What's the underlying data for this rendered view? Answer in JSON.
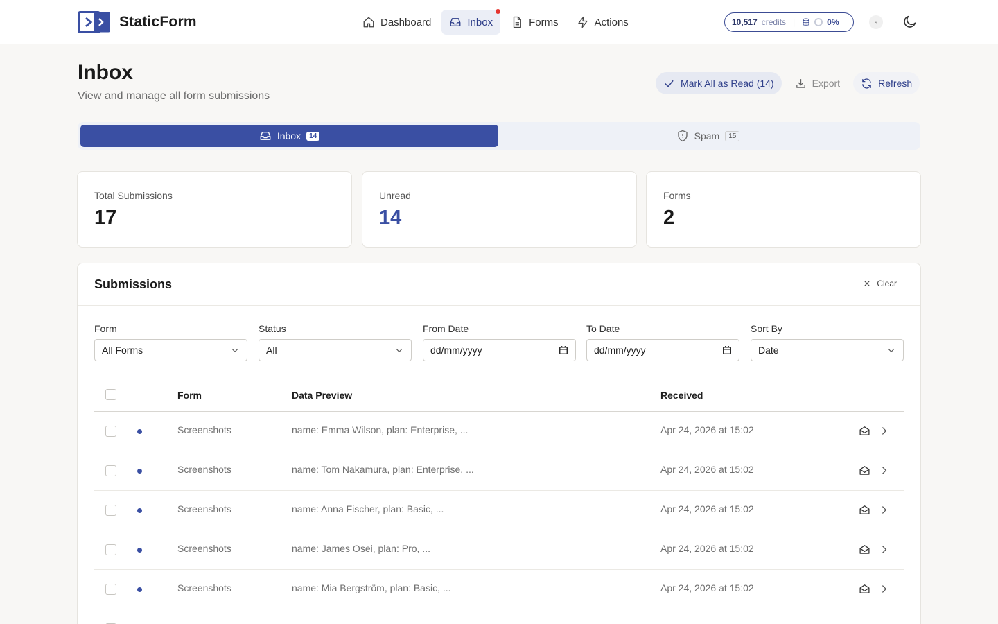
{
  "brand": {
    "name": "StaticForm",
    "accent": "#3a4fa3"
  },
  "nav": [
    {
      "label": "Dashboard",
      "icon": "home-icon",
      "active": false
    },
    {
      "label": "Inbox",
      "icon": "inbox-icon",
      "active": true
    },
    {
      "label": "Forms",
      "icon": "file-icon",
      "active": false
    },
    {
      "label": "Actions",
      "icon": "bolt-icon",
      "active": false
    }
  ],
  "credits": {
    "amount": "10,517",
    "label": "credits",
    "usage": "0%"
  },
  "user": {
    "initial": "s"
  },
  "page": {
    "title": "Inbox",
    "subtitle": "View and manage all form submissions"
  },
  "actions": {
    "mark_all": "Mark All as Read (14)",
    "export": "Export",
    "refresh": "Refresh"
  },
  "tabs": [
    {
      "label": "Inbox",
      "count": "14"
    },
    {
      "label": "Spam",
      "count": "15"
    }
  ],
  "stats": [
    {
      "label": "Total Submissions",
      "value": "17"
    },
    {
      "label": "Unread",
      "value": "14"
    },
    {
      "label": "Forms",
      "value": "2"
    }
  ],
  "submissions": {
    "title": "Submissions",
    "clear_label": "Clear",
    "filters": [
      {
        "label": "Form",
        "value": "All Forms",
        "type": "select"
      },
      {
        "label": "Status",
        "value": "All",
        "type": "select"
      },
      {
        "label": "From Date",
        "value": "dd/mm/yyyy",
        "type": "date"
      },
      {
        "label": "To Date",
        "value": "dd/mm/yyyy",
        "type": "date"
      },
      {
        "label": "Sort By",
        "value": "Date",
        "type": "select"
      }
    ],
    "columns": {
      "form": "Form",
      "preview": "Data Preview",
      "received": "Received"
    },
    "rows": [
      {
        "form": "Screenshots",
        "preview": "name: Emma Wilson, plan: Enterprise, ...",
        "received": "Apr 24, 2026 at 15:02",
        "unread": true
      },
      {
        "form": "Screenshots",
        "preview": "name: Tom Nakamura, plan: Enterprise, ...",
        "received": "Apr 24, 2026 at 15:02",
        "unread": true
      },
      {
        "form": "Screenshots",
        "preview": "name: Anna Fischer, plan: Basic, ...",
        "received": "Apr 24, 2026 at 15:02",
        "unread": true
      },
      {
        "form": "Screenshots",
        "preview": "name: James Osei, plan: Pro, ...",
        "received": "Apr 24, 2026 at 15:02",
        "unread": true
      },
      {
        "form": "Screenshots",
        "preview": "name: Mia Bergström, plan: Basic, ...",
        "received": "Apr 24, 2026 at 15:02",
        "unread": true
      }
    ]
  }
}
